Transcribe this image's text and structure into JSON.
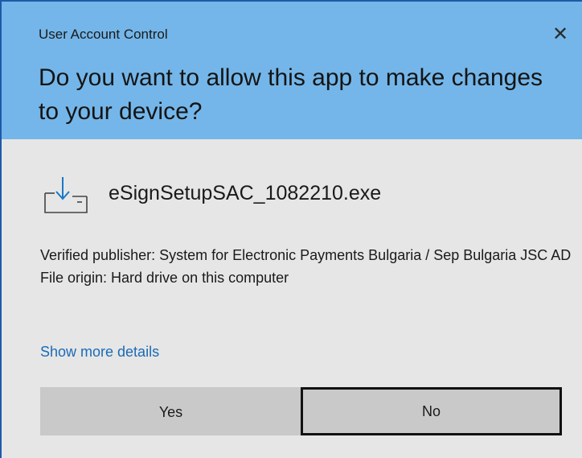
{
  "dialog": {
    "caption": "User Account Control",
    "close_glyph": "✕",
    "question": "Do you want to allow this app to make changes to your device?"
  },
  "app": {
    "icon": "installer-download-icon",
    "name": "eSignSetupSAC_1082210.exe"
  },
  "info": {
    "publisher_line": "Verified publisher: System for Electronic Payments Bulgaria / Sep Bulgaria JSC AD",
    "origin_line": "File origin: Hard drive on this computer"
  },
  "details_link": "Show more details",
  "buttons": {
    "yes": "Yes",
    "no": "No"
  },
  "colors": {
    "header": "#74b6e9",
    "body": "#e6e6e6",
    "link": "#1a6bb5",
    "button": "#c9c9c9"
  }
}
